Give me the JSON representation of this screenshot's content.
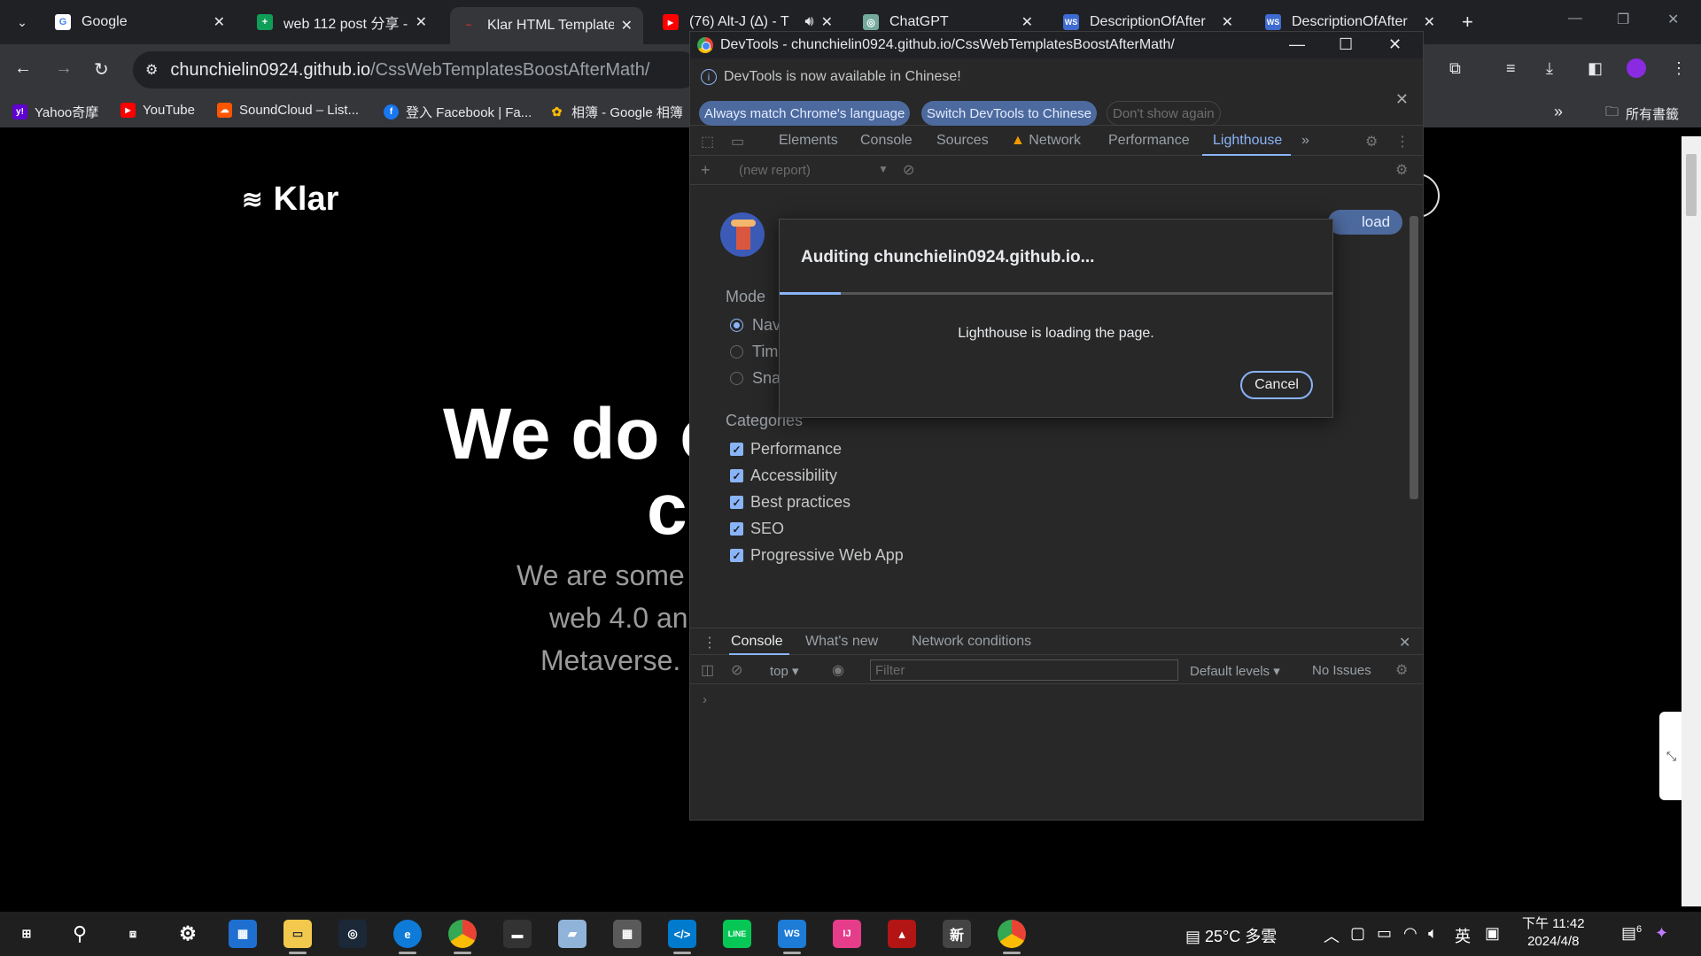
{
  "browser": {
    "tabs": [
      {
        "label": "Google",
        "fav_color": "#4285f4",
        "fav_text": "G"
      },
      {
        "label": "web 112 post 分享 -",
        "fav_color": "#0f9d58",
        "fav_text": "+"
      },
      {
        "label": "Klar HTML Template",
        "fav_color": "#d93025",
        "fav_text": "~"
      },
      {
        "label": "(76) Alt-J (∆) - T",
        "fav_color": "#ff0000",
        "fav_text": "▶"
      },
      {
        "label": "ChatGPT",
        "fav_color": "#74aa9c",
        "fav_text": "◎"
      },
      {
        "label": "DescriptionOfAfter",
        "fav_color": "#3d6bd1",
        "fav_text": "WS"
      },
      {
        "label": "DescriptionOfAfter",
        "fav_color": "#3d6bd1",
        "fav_text": "WS"
      }
    ],
    "url_host": "chunchielin0924.github.io",
    "url_path": "/CssWebTemplatesBoostAfterMath/",
    "bookmarks": [
      {
        "label": "Yahoo奇摩",
        "color": "#6001d2",
        "icon": "y!"
      },
      {
        "label": "YouTube",
        "color": "#ff0000",
        "icon": "▶"
      },
      {
        "label": "SoundCloud – List...",
        "color": "#ff5500",
        "icon": "☁"
      },
      {
        "label": "登入 Facebook | Fa...",
        "color": "#1877f2",
        "icon": "f"
      },
      {
        "label": "相簿 - Google 相簿",
        "color": "#fbbc05",
        "icon": "✿"
      }
    ],
    "all_bookmarks": "所有書籤"
  },
  "page": {
    "logo": "Klar",
    "hero_line1": "We do c",
    "hero_line2": "c",
    "hero_text1": "We are some",
    "hero_text2": "web 4.0 an",
    "hero_text3": "Metaverse."
  },
  "devtools": {
    "window_title": "DevTools - chunchielin0924.github.io/CssWebTemplatesBoostAfterMath/",
    "info_message": "DevTools is now available in Chinese!",
    "btn_match": "Always match Chrome's language",
    "btn_switch": "Switch DevTools to Chinese",
    "btn_dont_show": "Don't show again",
    "tabs": [
      "Elements",
      "Console",
      "Sources",
      "Network",
      "Performance",
      "Lighthouse"
    ],
    "report_select": "(new report)",
    "download_partial": "load",
    "mode_label": "Mode",
    "modes": [
      "Nav",
      "Tim",
      "Sna"
    ],
    "categories_label": "Categories",
    "categories": [
      "Performance",
      "Accessibility",
      "Best practices",
      "SEO",
      "Progressive Web App"
    ],
    "dialog": {
      "title": "Auditing chunchielin0924.github.io...",
      "status": "Lighthouse is loading the page.",
      "cancel": "Cancel",
      "progress": 0.11
    },
    "drawer_tabs": [
      "Console",
      "What's new",
      "Network conditions"
    ],
    "context": "top",
    "filter_placeholder": "Filter",
    "levels": "Default levels",
    "issues": "No Issues"
  },
  "taskbar": {
    "weather": "25°C 多雲",
    "ime": "英",
    "time": "下午 11:42",
    "date": "2024/4/8",
    "notifications": "6"
  }
}
